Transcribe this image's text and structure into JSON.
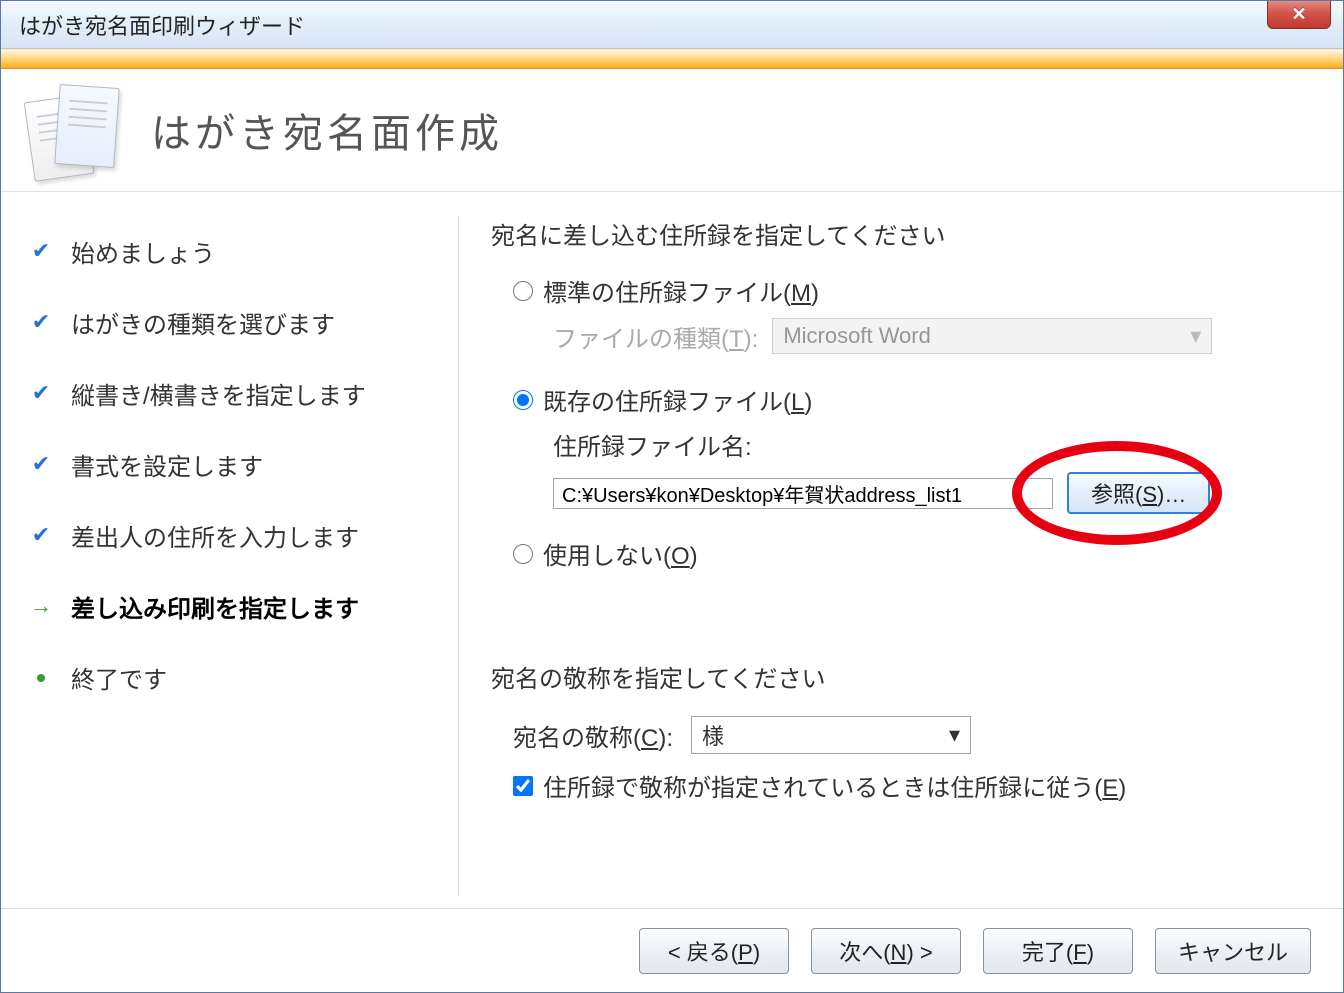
{
  "window": {
    "title": "はがき宛名面印刷ウィザード"
  },
  "header": {
    "title": "はがき宛名面作成"
  },
  "steps": [
    {
      "label": "始めましょう",
      "state": "done"
    },
    {
      "label": "はがきの種類を選びます",
      "state": "done"
    },
    {
      "label": "縦書き/横書きを指定します",
      "state": "done"
    },
    {
      "label": "書式を設定します",
      "state": "done"
    },
    {
      "label": "差出人の住所を入力します",
      "state": "done"
    },
    {
      "label": "差し込み印刷を指定します",
      "state": "current"
    },
    {
      "label": "終了です",
      "state": "pending"
    }
  ],
  "main": {
    "heading1": "宛名に差し込む住所録を指定してください",
    "radio_standard_prefix": "標準の住所録ファイル(",
    "radio_standard_key": "M",
    "radio_standard_suffix": ")",
    "filetype_label_prefix": "ファイルの種類(",
    "filetype_label_key": "T",
    "filetype_label_suffix": "):",
    "filetype_value": "Microsoft Word",
    "radio_existing_prefix": "既存の住所録ファイル(",
    "radio_existing_key": "L",
    "radio_existing_suffix": ")",
    "file_label": "住所録ファイル名:",
    "file_value": "C:¥Users¥kon¥Desktop¥年賀状address_list1",
    "browse_prefix": "参照(",
    "browse_key": "S",
    "browse_suffix": ")…",
    "radio_none_prefix": "使用しない(",
    "radio_none_key": "O",
    "radio_none_suffix": ")",
    "heading2": "宛名の敬称を指定してください",
    "honorific_label_prefix": "宛名の敬称(",
    "honorific_label_key": "C",
    "honorific_label_suffix": "):",
    "honorific_value": "様",
    "follow_check_prefix": "住所録で敬称が指定されているときは住所録に従う(",
    "follow_check_key": "E",
    "follow_check_suffix": ")"
  },
  "footer": {
    "back_prefix": "< 戻る(",
    "back_key": "P",
    "back_suffix": ")",
    "next_prefix": "次へ(",
    "next_key": "N",
    "next_suffix": ") >",
    "finish_prefix": "完了(",
    "finish_key": "F",
    "finish_suffix": ")",
    "cancel": "キャンセル"
  }
}
